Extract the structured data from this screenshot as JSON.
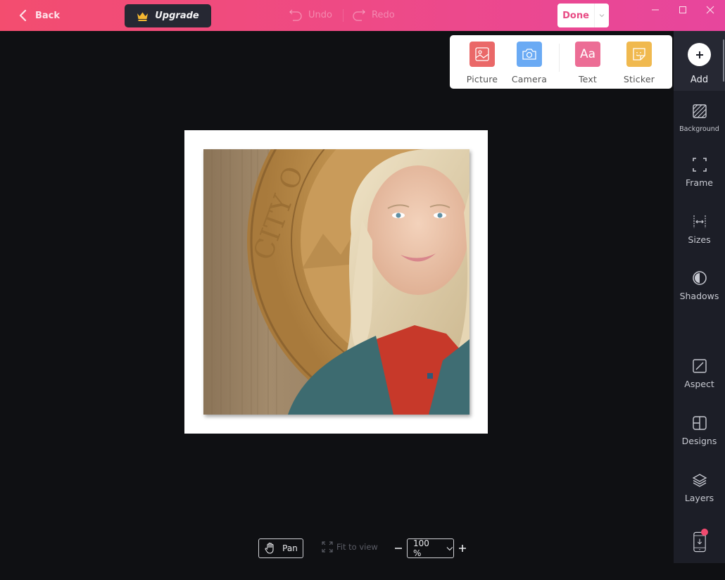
{
  "topbar": {
    "back_label": "Back",
    "upgrade_label": "Upgrade",
    "undo_label": "Undo",
    "redo_label": "Redo",
    "done_label": "Done",
    "undo_enabled": false,
    "redo_enabled": false
  },
  "add_popup": {
    "items": [
      {
        "label": "Picture",
        "icon": "picture-icon",
        "color": "#ea6868"
      },
      {
        "label": "Camera",
        "icon": "camera-icon",
        "color": "#6aaaf4"
      },
      {
        "label": "Text",
        "icon": "text-icon",
        "color": "#ec6d95"
      },
      {
        "label": "Sticker",
        "icon": "sticker-icon",
        "color": "#f0b94f"
      }
    ],
    "text_icon_glyph": "Aa"
  },
  "sidebar": {
    "add_label": "Add",
    "items": [
      {
        "label": "Background",
        "icon": "background-icon"
      },
      {
        "label": "Frame",
        "icon": "frame-icon"
      },
      {
        "label": "Sizes",
        "icon": "sizes-icon"
      },
      {
        "label": "Shadows",
        "icon": "shadows-icon"
      },
      {
        "label": "Aspect",
        "icon": "aspect-icon"
      },
      {
        "label": "Designs",
        "icon": "designs-icon"
      },
      {
        "label": "Layers",
        "icon": "layers-icon"
      },
      {
        "label": "",
        "icon": "phone-download-icon",
        "has_badge": true
      }
    ]
  },
  "canvas": {
    "photo_description": "Portrait of a smiling blonde woman in a teal blazer and red blouse in front of a bronze city seal on wood paneling",
    "seal_text": "CITY O"
  },
  "bottom_bar": {
    "pan_label": "Pan",
    "fit_label": "Fit to view",
    "zoom_value": "100 %"
  },
  "colors": {
    "accent_pink": "#e84c85",
    "topbar_start": "#f34d6f",
    "topbar_end": "#e7469d",
    "sidebar_bg": "#1c1e27",
    "canvas_bg": "#0f1013"
  }
}
